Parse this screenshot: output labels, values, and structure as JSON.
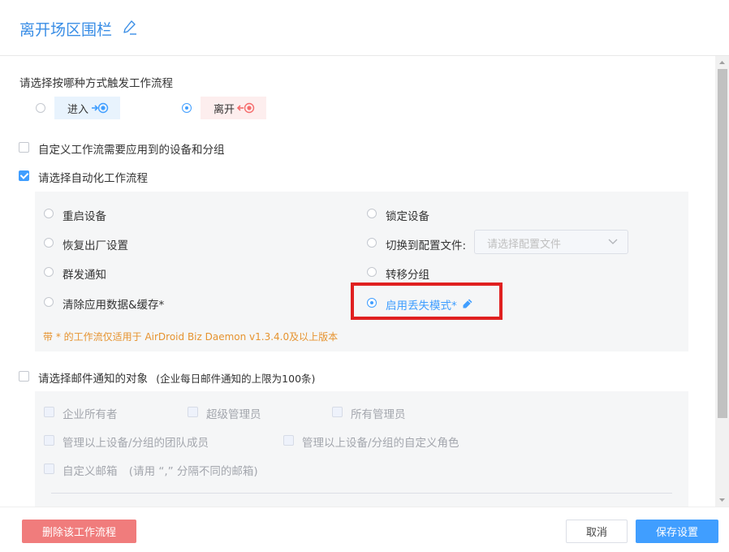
{
  "header": {
    "title": "离开场区围栏"
  },
  "trigger_section": {
    "label": "请选择按哪种方式触发工作流程",
    "options": [
      {
        "label": "进入",
        "selected": false,
        "color": "#e8f3fd"
      },
      {
        "label": "离开",
        "selected": true,
        "color": "#fdeeee"
      }
    ]
  },
  "custom_devices": {
    "label": "自定义工作流需要应用到的设备和分组",
    "checked": false
  },
  "automation": {
    "label": "请选择自动化工作流程",
    "checked": true,
    "options": [
      {
        "label": "重启设备",
        "selected": false
      },
      {
        "label": "锁定设备",
        "selected": false
      },
      {
        "label": "恢复出厂设置",
        "selected": false
      },
      {
        "label": "切换到配置文件:",
        "selected": false
      },
      {
        "label": "群发通知",
        "selected": false
      },
      {
        "label": "转移分组",
        "selected": false
      },
      {
        "label": "清除应用数据&缓存*",
        "selected": false
      },
      {
        "label": "启用丢失模式*",
        "selected": true
      }
    ],
    "config_select_placeholder": "请选择配置文件",
    "note": "带 * 的工作流仅适用于 AirDroid Biz Daemon v1.3.4.0及以上版本"
  },
  "email_section": {
    "label": "请选择邮件通知的对象",
    "hint": "(企业每日邮件通知的上限为100条)",
    "checked": false,
    "options": [
      {
        "label": "企业所有者"
      },
      {
        "label": "超级管理员"
      },
      {
        "label": "所有管理员"
      },
      {
        "label": "管理以上设备/分组的团队成员"
      },
      {
        "label": "管理以上设备/分组的自定义角色"
      },
      {
        "label": "自定义邮箱"
      }
    ],
    "custom_email_hint": "(请用 “,” 分隔不同的邮箱)"
  },
  "footer": {
    "delete_label": "删除该工作流程",
    "cancel_label": "取消",
    "save_label": "保存设置"
  },
  "colors": {
    "accent": "#409eff",
    "danger": "#f07c7c",
    "title": "#3a8ee6",
    "note": "#e6932f",
    "highlight": "#e02020"
  }
}
